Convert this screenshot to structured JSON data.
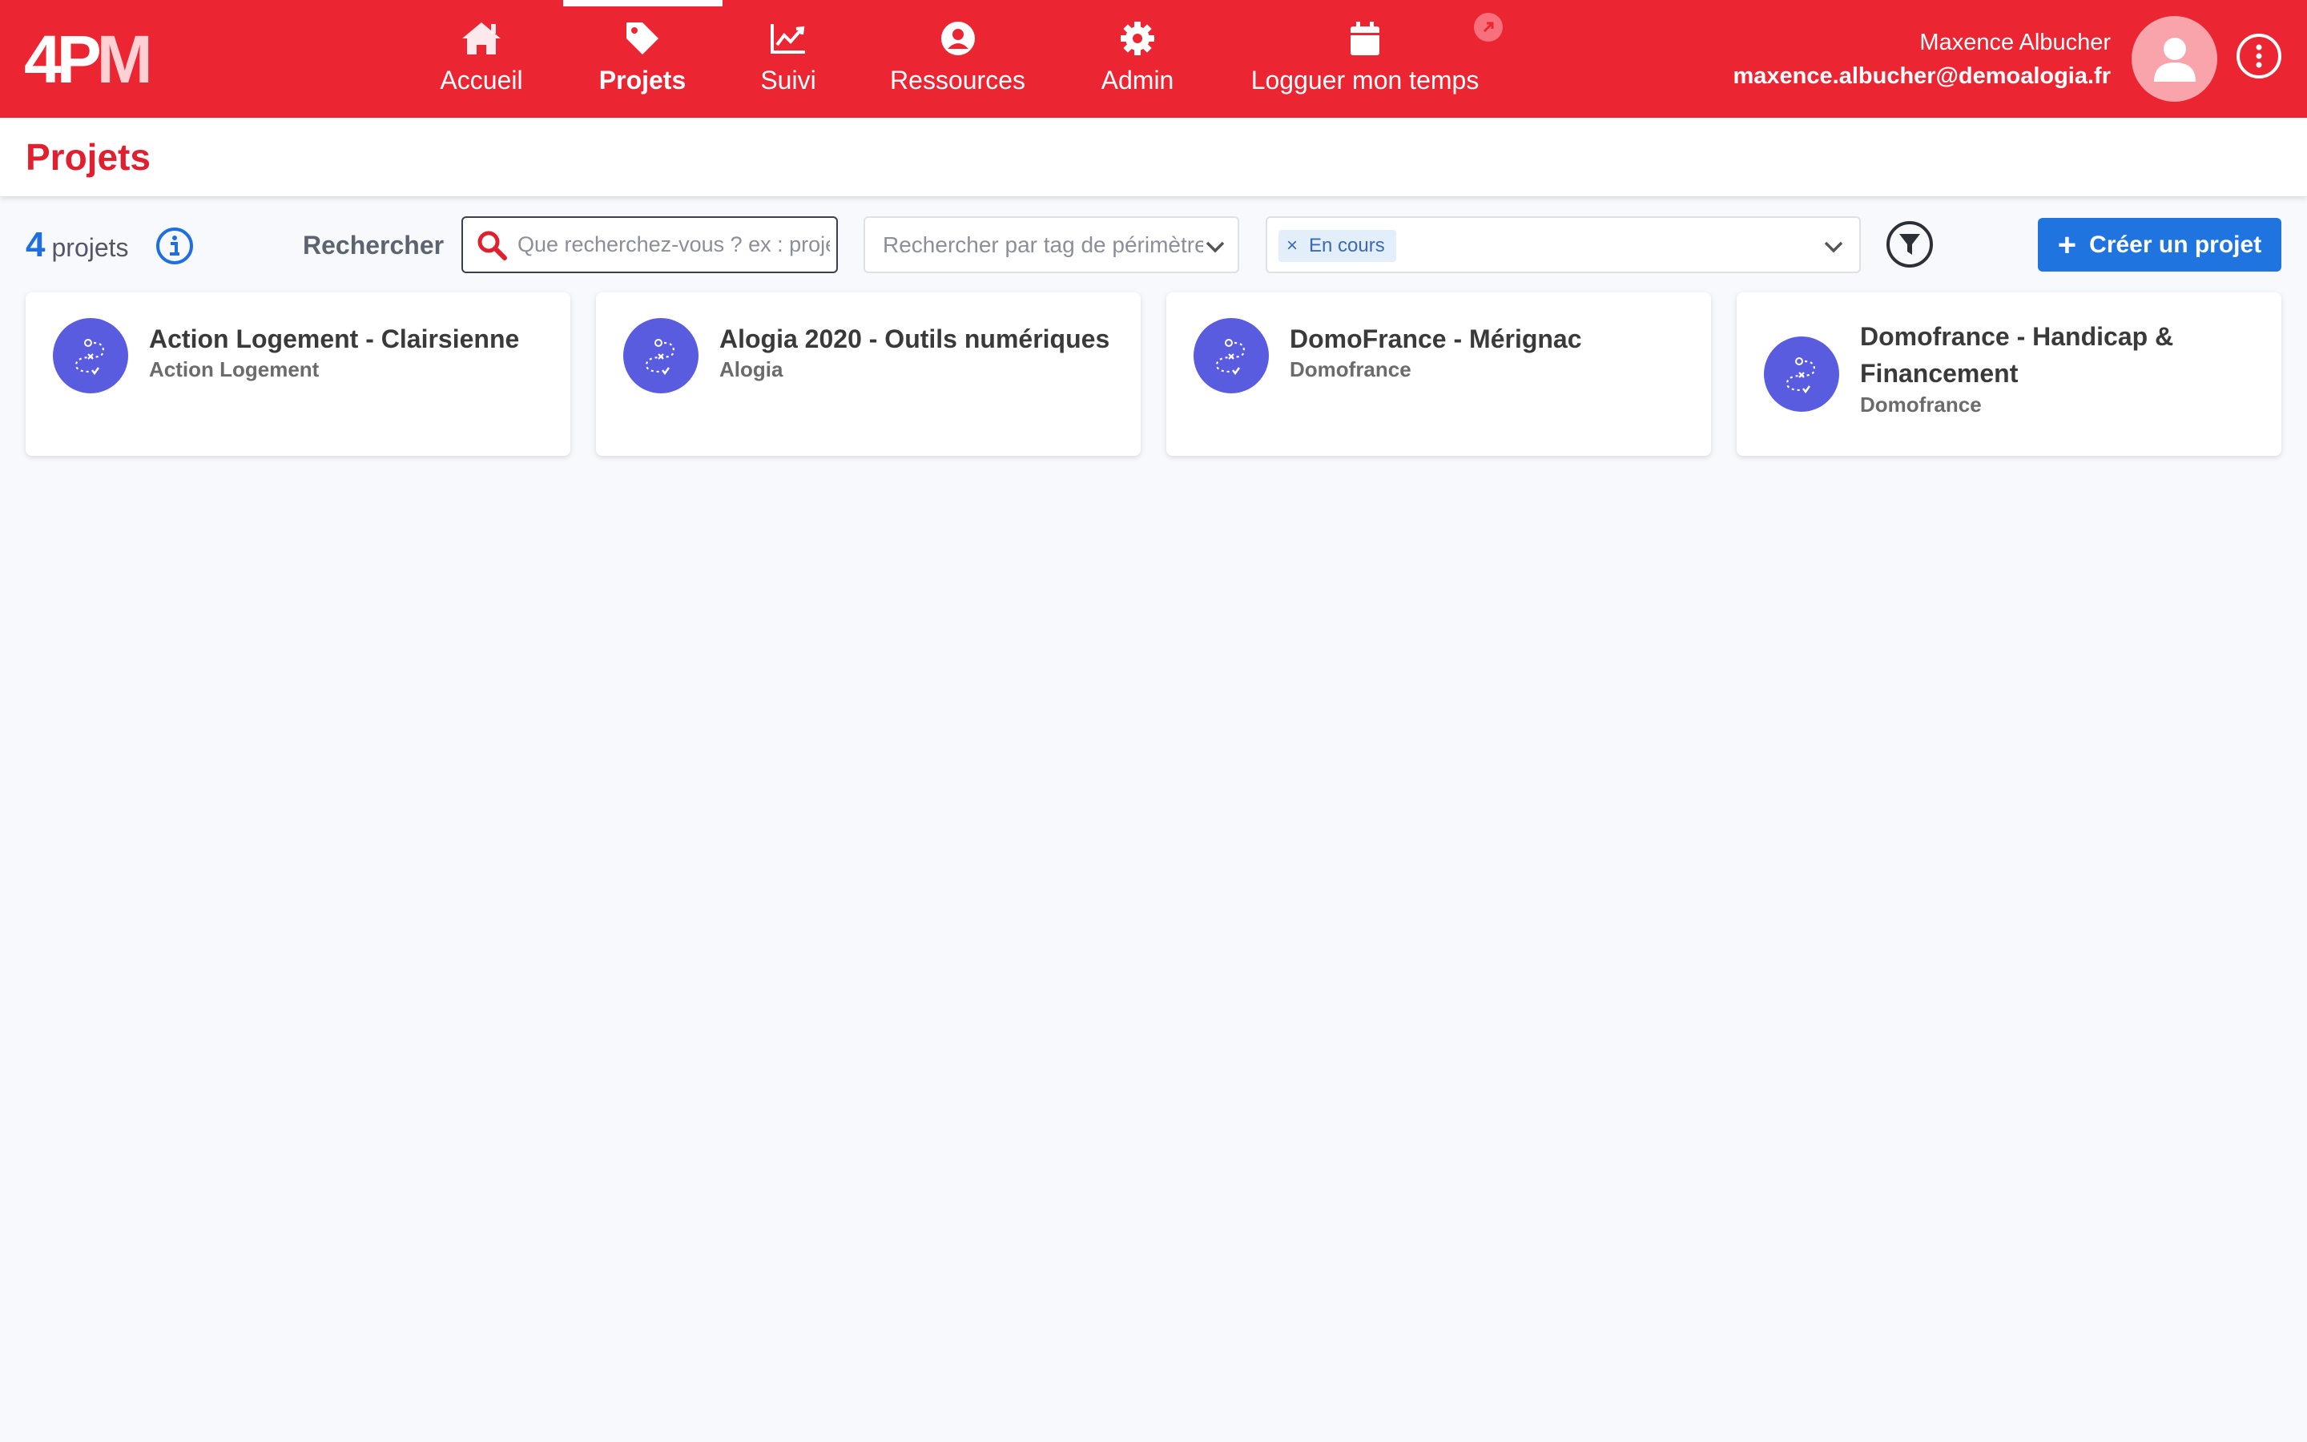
{
  "header": {
    "logo_text_a": "4P",
    "logo_text_b": "M",
    "nav": [
      {
        "label": "Accueil",
        "icon": "home-icon"
      },
      {
        "label": "Projets",
        "icon": "tag-icon",
        "active": true
      },
      {
        "label": "Suivi",
        "icon": "chart-line-icon"
      },
      {
        "label": "Ressources",
        "icon": "user-circle-icon"
      },
      {
        "label": "Admin",
        "icon": "gear-icon"
      },
      {
        "label": "Logguer mon temps",
        "icon": "calendar-icon"
      }
    ],
    "user": {
      "name": "Maxence Albucher",
      "email": "maxence.albucher@demoalogia.fr"
    }
  },
  "page": {
    "title": "Projets"
  },
  "toolbar": {
    "count_number": "4",
    "count_label": "projets",
    "search_label": "Rechercher",
    "search_placeholder": "Que recherchez-vous ? ex : projet",
    "tag_placeholder": "Rechercher par tag de périmètre",
    "status_chip": "En cours",
    "create_label": "Créer un projet"
  },
  "projects": [
    {
      "name": "Action Logement - Clairsienne",
      "client": "Action Logement"
    },
    {
      "name": "Alogia 2020 - Outils numériques",
      "client": "Alogia"
    },
    {
      "name": "DomoFrance - Mérignac",
      "client": "Domofrance"
    },
    {
      "name": "Domofrance - Handicap & Financement",
      "client": "Domofrance"
    }
  ],
  "colors": {
    "brand_red": "#ec2533",
    "primary_blue": "#1f74e0",
    "project_icon": "#5a5ce0"
  }
}
